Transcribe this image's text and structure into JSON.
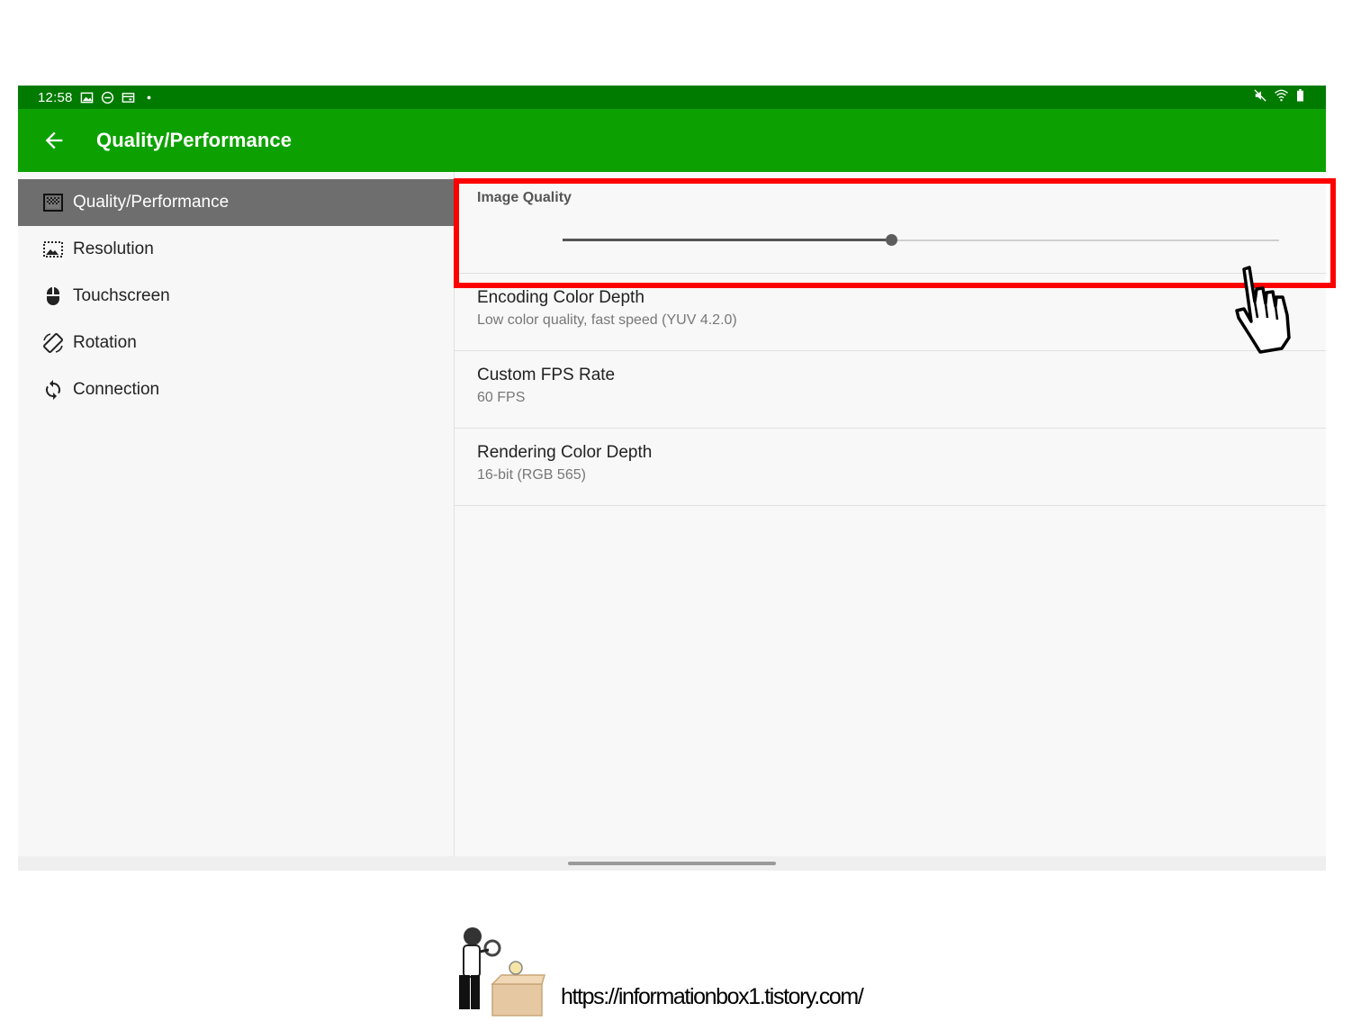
{
  "status_bar": {
    "time": "12:58",
    "left_icons": [
      "image-icon",
      "do-not-disturb-icon",
      "wallet-icon",
      "dot-icon"
    ],
    "right_icons": [
      "mute-icon",
      "wifi-icon",
      "battery-icon"
    ]
  },
  "app_bar": {
    "title": "Quality/Performance",
    "back_icon": "arrow-left-icon",
    "color": "#0ca100"
  },
  "sidebar": {
    "items": [
      {
        "label": "Quality/Performance",
        "icon": "quality-icon",
        "active": true
      },
      {
        "label": "Resolution",
        "icon": "resolution-icon",
        "active": false
      },
      {
        "label": "Touchscreen",
        "icon": "mouse-icon",
        "active": false
      },
      {
        "label": "Rotation",
        "icon": "rotation-icon",
        "active": false
      },
      {
        "label": "Connection",
        "icon": "sync-icon",
        "active": false
      }
    ]
  },
  "preferences": {
    "image_quality": {
      "title": "Image Quality",
      "slider_value": 0.46
    },
    "encoding": {
      "title": "Encoding Color Depth",
      "summary": "Low color quality, fast speed (YUV 4.2.0)"
    },
    "fps": {
      "title": "Custom FPS Rate",
      "summary": "60 FPS"
    },
    "rendering": {
      "title": "Rendering Color Depth",
      "summary": "16-bit (RGB 565)"
    }
  },
  "annotation": {
    "highlight_color": "#ff0000",
    "pointer": "hand-pointer-icon"
  },
  "footer": {
    "url": "https://informationbox1.tistory.com/"
  }
}
